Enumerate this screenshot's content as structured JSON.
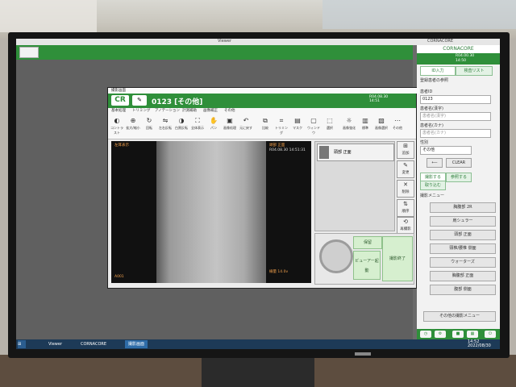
{
  "app": {
    "viewer_title": "Viewer",
    "brand": "CORNACORE",
    "time_line1": "R04.00.30",
    "time_line2": "14:50"
  },
  "taskbar": {
    "items": [
      "Viewer",
      "CORNACORE",
      "撮影画面"
    ],
    "clock": "14:52",
    "date": "2022/08/30"
  },
  "right_panel": {
    "tabs": [
      "ID入力",
      "検査リスト"
    ],
    "section_title": "登録患者の参照",
    "patient_id_label": "患者ID",
    "patient_id_value": "0123",
    "name_kanji_label": "患者名(漢字)",
    "name_kanji_placeholder": "患者名(漢字)",
    "name_kana_label": "患者名(カナ)",
    "name_kana_placeholder": "患者名(カナ)",
    "sex_label": "性別",
    "sex_value": "その他",
    "clear_label": "CLEAR",
    "mode_tabs": [
      "撮影する",
      "参照する",
      "取り込む"
    ],
    "menu_title": "撮影メニュー",
    "menu_items": [
      "胸腹部 2R",
      "肩シュラー",
      "頭部 正面",
      "頸椎/腰椎 側面",
      "ウォーターズ",
      "胸腹部 正面",
      "腹部 側面"
    ],
    "other_menu": "その他の撮影メニュー"
  },
  "dialog": {
    "title": "撮影画面",
    "patient": "0123 [その他]",
    "time_line1": "R04.08.30",
    "time_line2": "14:51",
    "tabs": [
      "基本処理",
      "トリミング",
      "アノテーション",
      "計測補助",
      "画像補正",
      "その他"
    ],
    "tools": [
      "コントラスト",
      "拡大/縮小",
      "回転",
      "左右反転",
      "白黒反転",
      "全体表示",
      "パン",
      "画像処理",
      "元に戻す",
      "比較",
      "トリミング",
      "マスク",
      "ウィンドウ",
      "選択",
      "画像強化",
      "標準",
      "画像選択",
      "その他"
    ],
    "image_left_label": "左耳表示",
    "image_right_label": "頭部 正面",
    "image_right_time": "R04.08.30 14:51:31",
    "image_bottom_left": "A001",
    "image_bottom_right": "線量 14.0v",
    "thumb_label": "頭部 正面",
    "side_buttons": [
      "追加",
      "変更",
      "削除",
      "順序",
      "再撮影"
    ],
    "save_label": "保留",
    "viewer_label": "ビューアー起動",
    "finish_label": "撮影終了"
  }
}
